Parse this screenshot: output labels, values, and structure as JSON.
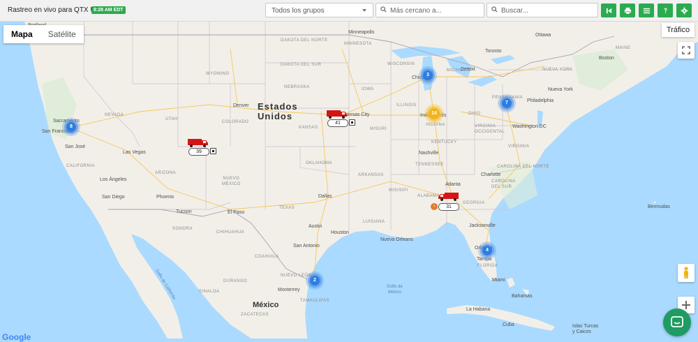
{
  "header": {
    "title": "Rastreo en vivo para QTX US",
    "time_badge": "8:28 AM EDT",
    "group_select": "Todos los grupos",
    "near_placeholder": "Más cercano a...",
    "search_placeholder": "Buscar..."
  },
  "toolbar_icons": [
    "skip-back-icon",
    "print-icon",
    "list-icon",
    "help-icon",
    "settings-icon"
  ],
  "map": {
    "type_tabs": [
      "Mapa",
      "Satélite"
    ],
    "active_tab": "Mapa",
    "traffic": "Tráfico",
    "country_label": "Estados\nUnidos",
    "mexico_label": "México",
    "google": "Google",
    "cities": {
      "portland": "Portland",
      "minneapolis": "Minneapolis",
      "ottawa": "Ottawa",
      "toronto": "Toronto",
      "detroit": "Detroit",
      "chicago": "Chicago",
      "boston": "Boston",
      "newyork": "Nueva York",
      "philadelphia": "Philadelphia",
      "washington": "Washington DC",
      "denver": "Denver",
      "kansascity": "Kansas City",
      "indianapolis": "Indianápolis",
      "sacramento": "Sacramento",
      "sanfrancisco": "San Francisco",
      "sanjose": "San José",
      "lasvegas": "Las Vegas",
      "losangeles": "Los Ángeles",
      "sandiego": "San Diego",
      "phoenix": "Phoenix",
      "tucson": "Tucson",
      "elpaso": "El Paso",
      "dallas": "Dallas",
      "austin": "Austin",
      "houston": "Houston",
      "sanantonio": "San Antonio",
      "nashville": "Nashville",
      "charlotte": "Charlotte",
      "atlanta": "Atlanta",
      "neworleans": "Nueva Orleans",
      "jacksonville": "Jacksonville",
      "orlando": "Orlando",
      "tampa": "Tampa",
      "miami": "Miami",
      "monterrey": "Monterrey",
      "habana": "La Habana",
      "bermudas": "Bermudas",
      "bahamas": "Bahamas",
      "turcas": "Islas Turcas\ny Caicos",
      "cuba": "Cuba",
      "golfomexico": "Golfo de\nMéxico",
      "golfocal": "Golfo de California"
    },
    "states": {
      "dakota_n": "DAKOTA DEL NORTE",
      "dakota_s": "DAKOTA DEL SUR",
      "nebraska": "NEBRASKA",
      "kansas": "KANSAS",
      "oklahoma": "OKLAHOMA",
      "texas": "TEXAS",
      "nuevo_mexico": "NUEVO\nMÉXICO",
      "arizona": "ARIZONA",
      "nevada": "NEVADA",
      "utah": "UTAH",
      "colorado": "COLORADO",
      "wyoming": "WYOMING",
      "iowa": "IOWA",
      "missouri": "MISURI",
      "illinois": "ILLINOIS",
      "indiana": "INDIANA",
      "ohio": "OHIO",
      "kentucky": "KENTUCKY",
      "tennessee": "TENNESSEE",
      "arkansas": "ARKANSAS",
      "misisipi": "MISISIPI",
      "alabama": "ALABAMA",
      "georgia": "GEORGIA",
      "florida": "FLORIDA",
      "carolina_s": "CAROLINA\nDEL SUR",
      "carolina_n": "CAROLINA DEL NORTE",
      "virginia": "VIRGINIA",
      "virginia_o": "VIRGINIA\nOCCIDENTAL",
      "pensilvania": "PENSILVANIA",
      "nuevayork": "NUEVA YORK",
      "wisconsin": "WISCONSIN",
      "michigan": "MICHIGAN",
      "minnesota": "MINNESOTA",
      "luisiana": "LUISIANA",
      "california": "CALIFORNIA",
      "chihuahua": "CHIHUAHUA",
      "sonora": "SONORA",
      "coahuila": "COAHUILA",
      "durango": "DURANGO",
      "sinaloa": "SINALOA",
      "nuevoleon": "NUEVO LEÓN",
      "zacatecas": "ZACATECAS",
      "tamaulipas": "TAMAULIPAS",
      "maine": "MAINE"
    },
    "clusters": [
      {
        "id": "cluster-sf",
        "count": "8",
        "color": "blue"
      },
      {
        "id": "cluster-chicago",
        "count": "3",
        "color": "blue"
      },
      {
        "id": "cluster-indy",
        "count": "14",
        "color": "orange"
      },
      {
        "id": "cluster-va",
        "count": "7",
        "color": "blue"
      },
      {
        "id": "cluster-fl",
        "count": "4",
        "color": "blue"
      },
      {
        "id": "cluster-tx",
        "count": "2",
        "color": "blue"
      }
    ],
    "trucks": [
      {
        "id": "truck-39",
        "label": "39"
      },
      {
        "id": "truck-41",
        "label": "41"
      },
      {
        "id": "truck-31",
        "label": "31"
      }
    ]
  },
  "colors": {
    "accent": "#2bab4f",
    "cluster_blue": "#2f7de0",
    "cluster_orange": "#f0b323",
    "truck": "#d71414",
    "land": "#f2efe9",
    "water": "#aadaff"
  }
}
